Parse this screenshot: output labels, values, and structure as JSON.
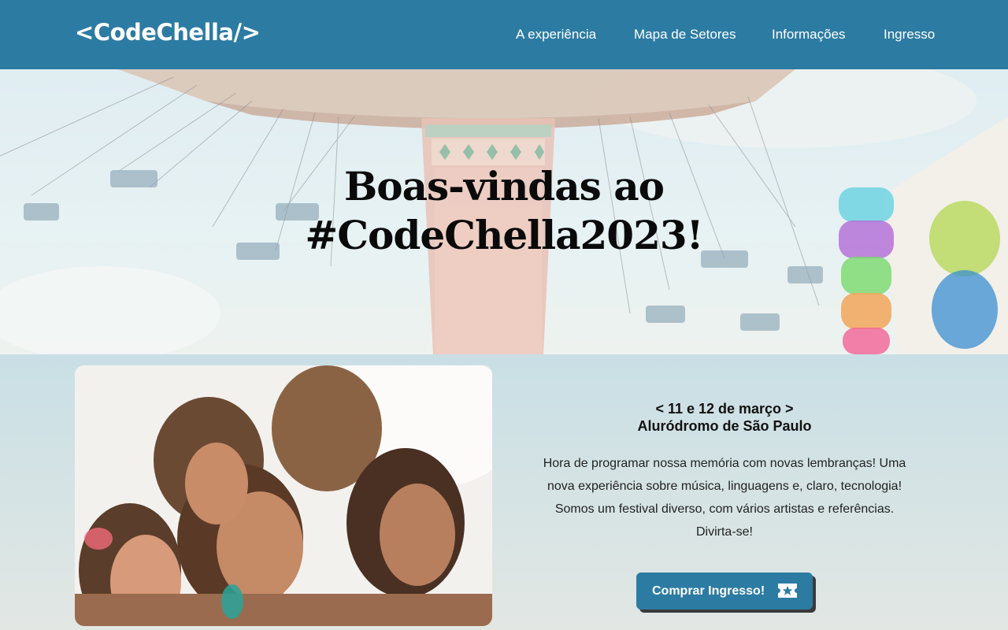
{
  "header": {
    "logo": "<CodeChella/>",
    "nav": [
      "A experiência",
      "Mapa de Setores",
      "Informações",
      "Ingresso"
    ]
  },
  "hero": {
    "title_line1": "Boas-vindas ao",
    "title_line2": "#CodeChella2023!"
  },
  "event": {
    "date": "< 11 e 12 de março >",
    "venue": "Aluródromo de São Paulo",
    "description": [
      "Hora de programar nossa memória com novas lembranças! Uma",
      "nova experiência sobre música, linguagens e, claro, tecnologia!",
      "Somos um festival diverso, com vários artistas e referências.",
      "Divirta-se!"
    ],
    "cta_label": "Comprar Ingresso!"
  },
  "icons": {
    "cta": "ticket-star-icon"
  },
  "colors": {
    "primary": "#2c7ba3",
    "text": "#111111"
  }
}
